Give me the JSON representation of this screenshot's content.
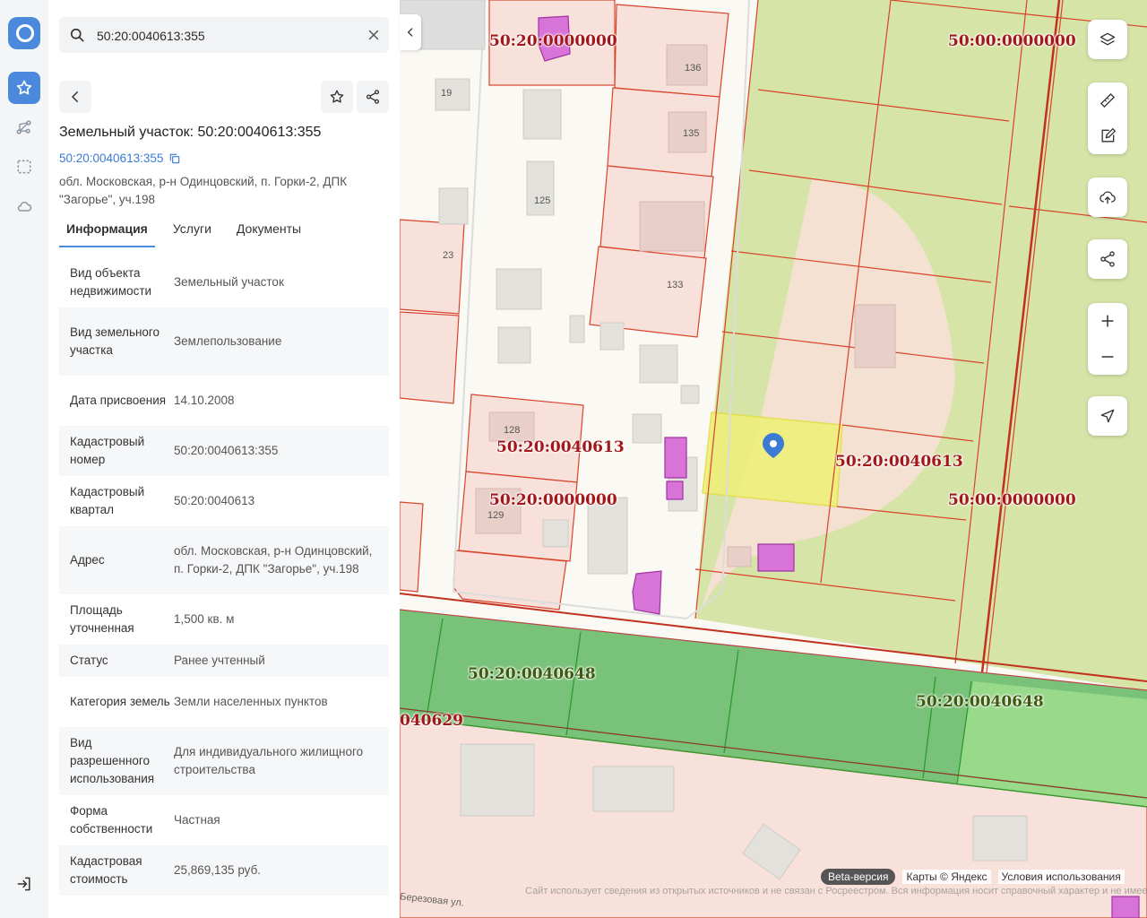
{
  "search": {
    "value": "50:20:0040613:355"
  },
  "panel": {
    "title": "Земельный участок: 50:20:0040613:355",
    "cad_link": "50:20:0040613:355",
    "address": "обл. Московская, р-н Одинцовский, п. Горки-2, ДПК \"Загорье\", уч.198",
    "tabs": [
      "Информация",
      "Услуги",
      "Документы"
    ],
    "rows": [
      {
        "k": "Вид объекта недвижимости",
        "v": "Земельный участок"
      },
      {
        "k": "Вид земельного участка",
        "v": "Землепользование"
      },
      {
        "k": "Дата присвоения",
        "v": "14.10.2008"
      },
      {
        "k": "Кадастровый номер",
        "v": "50:20:0040613:355"
      },
      {
        "k": "Кадастровый квартал",
        "v": "50:20:0040613"
      },
      {
        "k": "Адрес",
        "v": "обл. Московская, р-н Одинцовский, п. Горки-2, ДПК \"Загорье\", уч.198"
      },
      {
        "k": "Площадь уточненная",
        "v": "1,500 кв. м"
      },
      {
        "k": "Статус",
        "v": "Ранее учтенный"
      },
      {
        "k": "Категория земель",
        "v": "Земли населенных пунктов"
      },
      {
        "k": "Вид разрешенного использования",
        "v": "Для индивидуального жилищного строительства"
      },
      {
        "k": "Форма собственности",
        "v": "Частная"
      },
      {
        "k": "Кадастровая стоимость",
        "v": "25,869,135 руб."
      }
    ]
  },
  "map": {
    "labels": {
      "l1": "50:20:0000000",
      "l2": "50:00:0000000",
      "l3": "50:20:0040613",
      "l4": "50:20:0040613",
      "l5": "50:20:0000000",
      "l6": "50:00:0000000",
      "l7": "50:20:0040648",
      "l8": "50:20:0040648",
      "l9": "040629"
    },
    "houses": {
      "h136": "136",
      "h19": "19",
      "h135": "135",
      "h125": "125",
      "h23": "23",
      "h133": "133",
      "h128": "128",
      "h129": "129"
    },
    "beta": "Beta-версия",
    "copyright": "Карты © Яндекс",
    "terms": "Условия использования",
    "street": "Березовая ул.",
    "disclaimer": "Сайт использует сведения из открытых источников и не связан с Росреестром. Вся информация носит справочный характер и не имеет юридической силы. За официальными сведениями обращайтесь в Росреестр"
  },
  "colors": {
    "accent": "#4a89dc",
    "parcel_border": "#d9432b",
    "selected": "#eef07a",
    "quarter_green": "#5cb85c"
  },
  "icons": [
    "logo-icon",
    "star-icon",
    "route-icon",
    "select-area-icon",
    "cloud-icon",
    "logout-icon",
    "search-icon",
    "close-icon",
    "back-icon",
    "share-icon",
    "copy-icon",
    "layers-icon",
    "ruler-icon",
    "edit-icon",
    "upload-icon",
    "zoom-in-icon",
    "zoom-out-icon",
    "locate-icon",
    "location-pin-icon"
  ]
}
